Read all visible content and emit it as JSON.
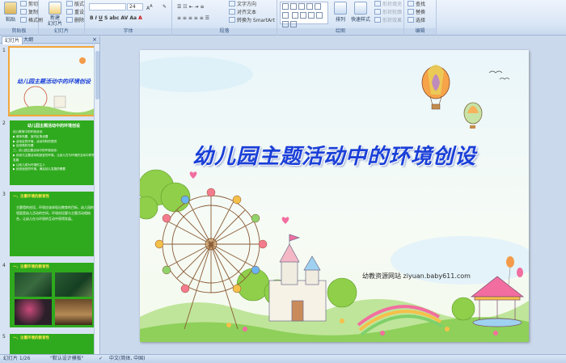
{
  "ribbon": {
    "clipboard": {
      "paste": "粘贴",
      "cut": "剪切",
      "copy": "复制",
      "format_painter": "格式刷",
      "group_label": "剪贴板"
    },
    "slides": {
      "new_slide": "新建\n幻灯片",
      "layout": "版式",
      "reset": "重设",
      "delete": "删除",
      "group_label": "幻灯片"
    },
    "font": {
      "font_size": "24",
      "group_label": "字体"
    },
    "paragraph": {
      "text_direction": "文字方向",
      "align_text": "对齐文本",
      "convert_smartart": "转换为 SmartArt",
      "group_label": "段落"
    },
    "drawing": {
      "arrange": "排列",
      "quick_styles": "快速样式",
      "shape_fill": "形状填充",
      "shape_outline": "形状轮廓",
      "shape_effects": "形状效果",
      "group_label": "绘图"
    },
    "editing": {
      "find": "查找",
      "replace": "替换",
      "select": "选择",
      "group_label": "编辑"
    }
  },
  "left_pane": {
    "tabs": [
      "幻灯片",
      "大纲"
    ],
    "close": "×",
    "thumbnails": [
      {
        "num": "1",
        "title": "幼儿园主题活动中的环境创设"
      },
      {
        "num": "2",
        "title": "幼儿园主题活动中的环境创设",
        "lines": [
          "幼儿教育中的环境创设：",
          "▶ 墙饰布置、室内区角设置",
          "▶ 活动区的环境、活动材料的提供",
          "▶ 自然角的布置",
          "三、幼儿园主题活动中的环境创设：",
          "▶ 创设与主题活动相适宜的环境，让幼儿在与环境的互动中获得发展",
          "▶ 让幼儿成为环境的主人",
          "▶ 创设适宜的环境，满足幼儿发展的需要"
        ]
      },
      {
        "num": "3",
        "title": "一、注重环境的教育性",
        "lines": [
          "主题墙的创设，环境应该体现出教育的目标，幼儿园的墙面是幼儿活动的空间，环境创设要与主题活动相结合，让幼儿在与环境的互动中获得发展。"
        ]
      },
      {
        "num": "4",
        "title": "一、注重环境的教育性"
      },
      {
        "num": "5",
        "title": "一、注重环境的教育性"
      }
    ]
  },
  "slide": {
    "title": "幼儿园主题活动中的环境创设",
    "watermark": "幼教资源网站  ziyuan.baby611.com"
  },
  "status_bar": {
    "slide_counter": "幻灯片 1/26",
    "theme": "\"默认设计模板\"",
    "language": "中文(简体, 中国)"
  },
  "colors": {
    "title_blue": "#1a3fd8",
    "thumb_green": "#2faa1e",
    "selection_orange": "#f3a53b",
    "ribbon_bg": "#dbe7f6"
  }
}
